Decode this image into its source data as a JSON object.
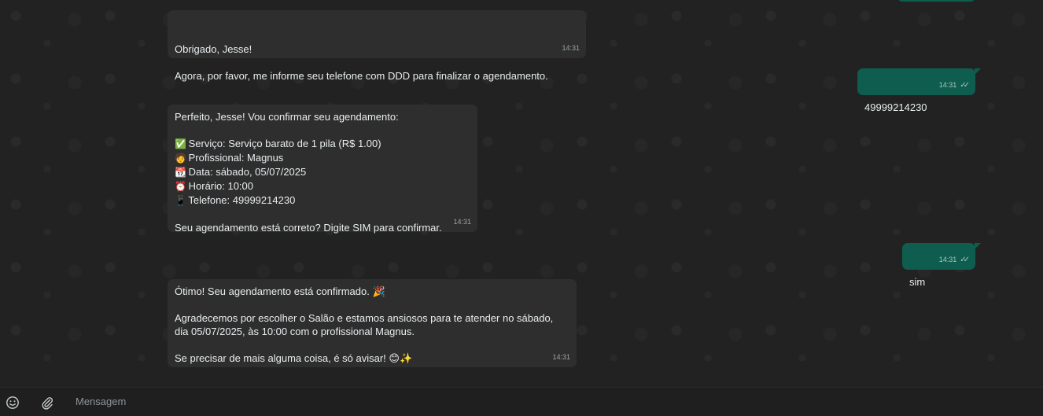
{
  "messages": [
    {
      "id": "m1",
      "direction": "in",
      "lines": [
        "Obrigado, Jesse!",
        "",
        "Agora, por favor, me informe seu telefone com DDD para finalizar o agendamento."
      ],
      "time": "14:31"
    },
    {
      "id": "m2",
      "direction": "out",
      "text": "49999214230",
      "time": "14:31",
      "status": "read"
    },
    {
      "id": "m3",
      "direction": "in",
      "intro": "Perfeito, Jesse! Vou confirmar seu agendamento:",
      "items": [
        {
          "icon": "check-box-icon",
          "glyph": "✅",
          "text": "Serviço: Serviço barato de 1 pila (R$ 1.00)"
        },
        {
          "icon": "person-icon",
          "glyph": "🧑",
          "text": "Profissional: Magnus"
        },
        {
          "icon": "calendar-icon",
          "glyph": "📆",
          "text": "Data: sábado, 05/07/2025"
        },
        {
          "icon": "clock-icon",
          "glyph": "⏰",
          "text": "Horário: 10:00"
        },
        {
          "icon": "phone-icon",
          "glyph": "📱",
          "text": "Telefone: 49999214230"
        }
      ],
      "outro": "Seu agendamento está correto? Digite SIM para confirmar.",
      "time": "14:31"
    },
    {
      "id": "m4",
      "direction": "out",
      "text": "sim",
      "time": "14:31",
      "status": "read"
    },
    {
      "id": "m5",
      "direction": "in",
      "line1": "Ótimo! Seu agendamento está confirmado. 🎉",
      "para2": "Agradecemos por escolher o Salão e estamos ansiosos para te atender no sábado, dia 05/07/2025, às 10:00 com o profissional Magnus.",
      "line3": "Se precisar de mais alguma coisa, é só avisar! 😊✨",
      "time": "14:31"
    }
  ],
  "composer": {
    "placeholder": "Mensagem",
    "emoji_icon": "emoji-icon",
    "attach_icon": "paperclip-icon"
  },
  "colors": {
    "background": "#222222",
    "incoming_bubble": "#2e2e2e",
    "outgoing_bubble": "#0e5d4e",
    "text": "#e9edef"
  }
}
